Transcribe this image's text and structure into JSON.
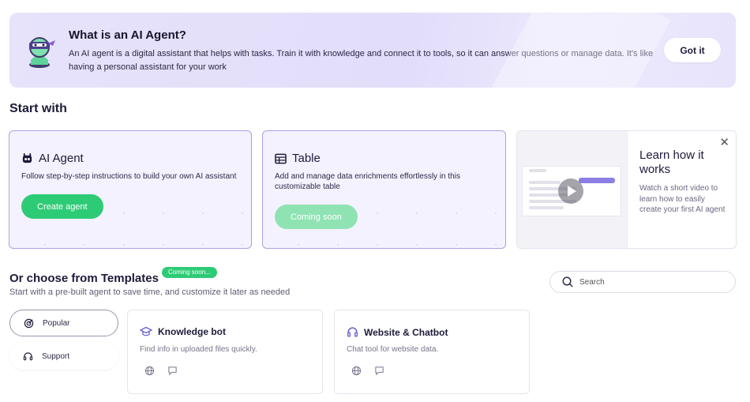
{
  "banner": {
    "title": "What is an AI Agent?",
    "text": "An AI agent is a digital assistant that helps with tasks. Train it with knowledge and connect it to tools, so it can answer questions or manage data. It's like having a personal assistant for your work",
    "button": "Got it"
  },
  "start": {
    "title": "Start with",
    "agent": {
      "title": "AI Agent",
      "desc": "Follow step-by-step instructions to build your own AI assistant",
      "button": "Create agent",
      "icon": "robot-icon"
    },
    "table": {
      "title": "Table",
      "desc": "Add and manage data enrichments effortlessly in this customizable table",
      "button": "Coming soon",
      "icon": "table-icon"
    },
    "learn": {
      "title": "Learn how it works",
      "text": "Watch a short video to learn how to easily create your first AI agent",
      "close": "✕"
    }
  },
  "templates": {
    "title": "Or choose from Templates",
    "badge": "Coming soon...",
    "subtitle": "Start with a pre-built agent to save time, and customize it later as needed",
    "search_placeholder": "Search",
    "categories": [
      {
        "label": "Popular",
        "icon": "target-icon"
      },
      {
        "label": "Support",
        "icon": "headset-icon"
      }
    ],
    "cards": [
      {
        "title": "Knowledge bot",
        "desc": "Find info in uploaded files quickly.",
        "icon": "graduation-cap-icon"
      },
      {
        "title": "Website & Chatbot",
        "desc": "Chat tool for website data.",
        "icon": "headphones-icon"
      }
    ]
  },
  "colors": {
    "accent_green": "#2ecb76",
    "accent_purple": "#a9a2e4",
    "banner_bg": "#e4e0fb"
  }
}
